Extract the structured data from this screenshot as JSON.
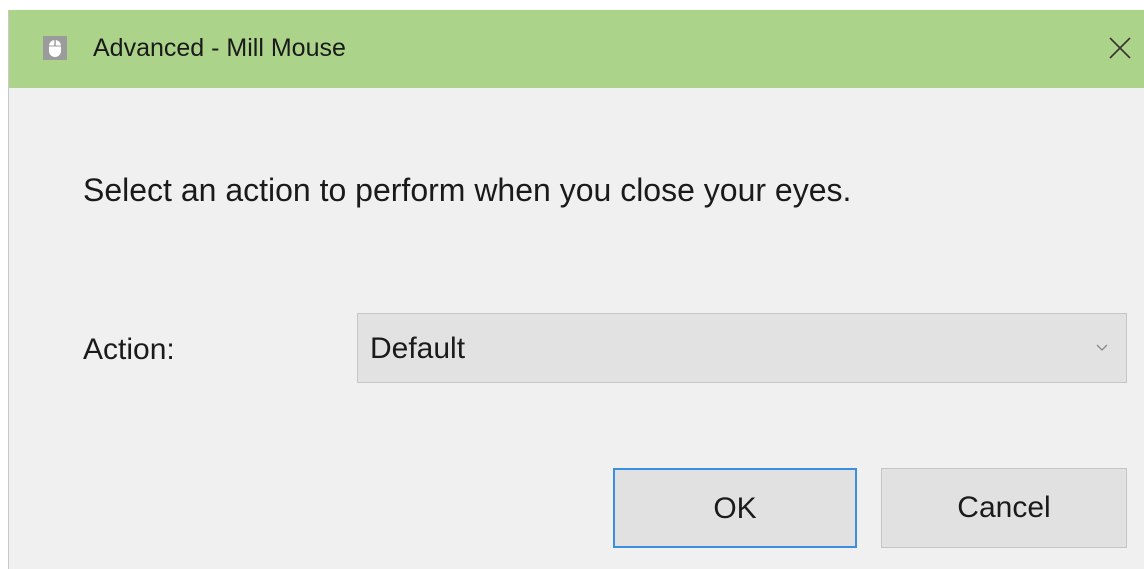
{
  "window": {
    "title": "Advanced - Mill Mouse",
    "app_icon": "mouse-icon",
    "close_icon": "close-icon",
    "titlebar_color": "#acd38a"
  },
  "content": {
    "prompt": "Select an action to perform when you close your eyes."
  },
  "action": {
    "label": "Action:",
    "selected_value": "Default"
  },
  "buttons": {
    "ok_label": "OK",
    "cancel_label": "Cancel"
  }
}
